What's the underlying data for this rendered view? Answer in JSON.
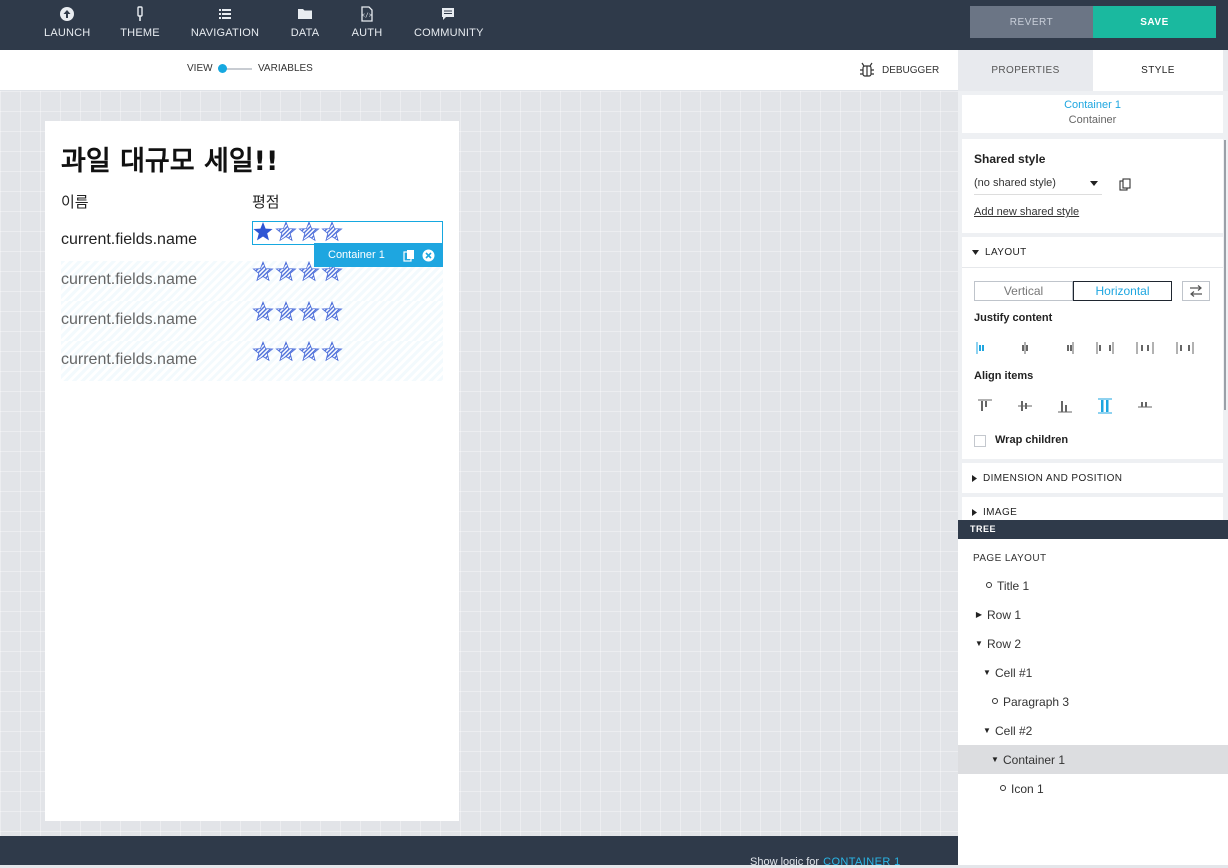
{
  "topnav": {
    "items": [
      {
        "label": "LAUNCH",
        "icon": "launch-icon"
      },
      {
        "label": "THEME",
        "icon": "theme-icon"
      },
      {
        "label": "NAVIGATION",
        "icon": "navigation-icon"
      },
      {
        "label": "DATA",
        "icon": "data-icon"
      },
      {
        "label": "AUTH",
        "icon": "auth-icon"
      },
      {
        "label": "COMMUNITY",
        "icon": "community-icon"
      }
    ],
    "revert_label": "REVERT",
    "save_label": "SAVE"
  },
  "subbar": {
    "view_label": "VIEW",
    "variables_label": "VARIABLES",
    "debugger_label": "DEBUGGER"
  },
  "page": {
    "title": "과일 대규모 세일!!",
    "col_name": "이름",
    "col_rating": "평점",
    "rows": [
      {
        "name": "current.fields.name",
        "filled_stars": 1
      },
      {
        "name": "current.fields.name",
        "filled_stars": 0
      },
      {
        "name": "current.fields.name",
        "filled_stars": 0
      },
      {
        "name": "current.fields.name",
        "filled_stars": 0
      }
    ],
    "selection_label": "Container 1"
  },
  "bottom": {
    "logic_label": "Show logic for",
    "logic_target": "CONTAINER 1"
  },
  "panel": {
    "tabs": [
      "PROPERTIES",
      "STYLE"
    ],
    "active_tab": "STYLE",
    "component_name": "Container 1",
    "component_type": "Container",
    "shared_style_title": "Shared style",
    "shared_style_value": "(no shared style)",
    "add_shared_style": "Add new shared style",
    "layout_label": "LAYOUT",
    "vertical_label": "Vertical",
    "horizontal_label": "Horizontal",
    "justify_label": "Justify content",
    "align_label": "Align items",
    "wrap_label": "Wrap children",
    "dimension_label": "DIMENSION AND POSITION",
    "image_label": "IMAGE"
  },
  "tree": {
    "header": "TREE",
    "title": "PAGE LAYOUT",
    "nodes": [
      {
        "label": "Title 1",
        "marker": "dot"
      },
      {
        "label": "Row 1",
        "marker": "collapsed"
      },
      {
        "label": "Row 2",
        "marker": "expanded"
      },
      {
        "label": "Cell #1",
        "marker": "expanded"
      },
      {
        "label": "Paragraph 3",
        "marker": "dot"
      },
      {
        "label": "Cell #2",
        "marker": "expanded"
      },
      {
        "label": "Container 1",
        "marker": "expanded",
        "selected": true
      },
      {
        "label": "Icon 1",
        "marker": "dot"
      }
    ]
  },
  "colors": {
    "nav_bg": "#2f3a4a",
    "accent": "#1ea6e0",
    "save": "#1ab99f",
    "star": "#2f55d4"
  }
}
